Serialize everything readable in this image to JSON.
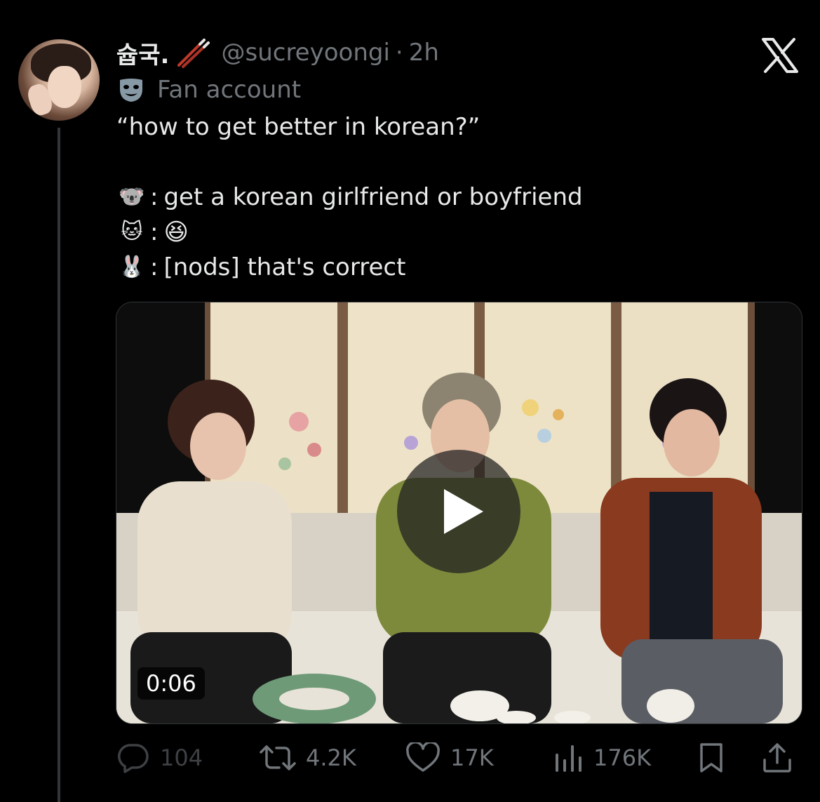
{
  "tweet": {
    "display_name": "슙국.",
    "handle": "@sucreyoongi",
    "separator": "·",
    "time": "2h",
    "label": "Fan account",
    "text_lines": [
      {
        "emoji": "",
        "text": "“how to get better in korean?”"
      },
      {
        "emoji": "🐨",
        "text": "get a korean girlfriend or boyfriend"
      },
      {
        "emoji": "🐱",
        "text": "😆"
      },
      {
        "emoji": "🐰",
        "text": "[nods] that's correct"
      }
    ],
    "colon": ":"
  },
  "media": {
    "type": "video",
    "duration": "0:06"
  },
  "actions": {
    "replies": "104",
    "reposts": "4.2K",
    "likes": "17K",
    "views": "176K"
  },
  "icons": {
    "reply": "reply-icon",
    "repost": "repost-icon",
    "like": "heart-icon",
    "views": "views-icon",
    "bookmark": "bookmark-icon",
    "share": "share-icon",
    "brand": "x-logo-icon",
    "label": "mask-icon",
    "play": "play-icon"
  },
  "colors": {
    "background": "#000000",
    "text_primary": "#e7e9ea",
    "text_secondary": "#71767b"
  }
}
